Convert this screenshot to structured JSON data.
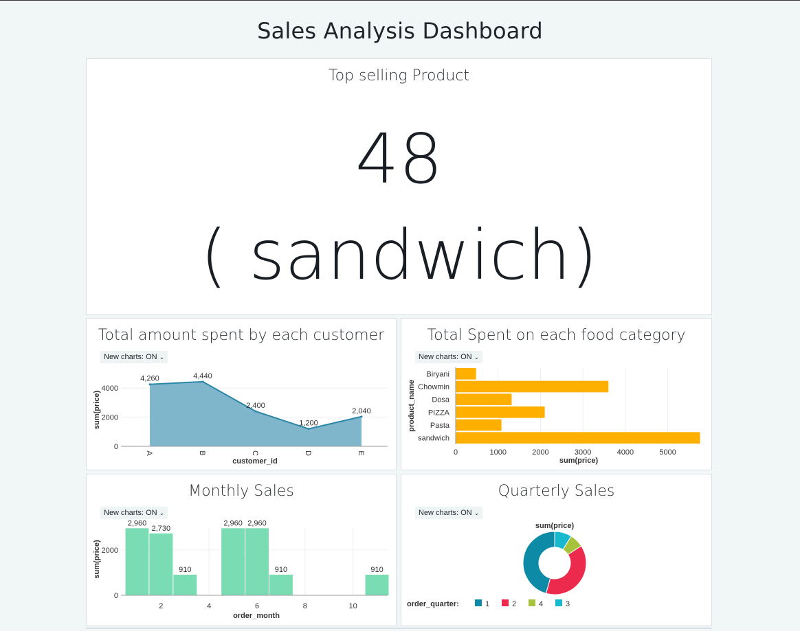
{
  "dashboard": {
    "title": "Sales Analysis Dashboard"
  },
  "kpi": {
    "title": "Top selling Product",
    "value": "48",
    "subtitle": "( sandwich)"
  },
  "toggle_label": "New charts: ON",
  "colors": {
    "area": "#7fb6cb",
    "area_line": "#2c86a6",
    "bars_h": "#ffaf00",
    "bars_month": "#7adcb3",
    "pie": [
      "#0c8aa6",
      "#ec2a4d",
      "#a7c33b",
      "#18b9cf"
    ]
  },
  "chart_data": [
    {
      "id": "customer",
      "type": "area",
      "title": "Total amount spent by each customer",
      "xlabel": "customer_id",
      "ylabel": "sum(price)",
      "categories": [
        "A",
        "B",
        "C",
        "D",
        "E"
      ],
      "values": [
        4260,
        4440,
        2400,
        1200,
        2040
      ],
      "value_labels": [
        "4,260",
        "4,440",
        "2,400",
        "1,200",
        "2,040"
      ],
      "ylim": [
        0,
        5000
      ],
      "yticks": [
        0,
        2000,
        4000
      ]
    },
    {
      "id": "category",
      "type": "bar",
      "orientation": "horizontal",
      "title": "Total Spent on each food category",
      "xlabel": "sum(price)",
      "ylabel": "product_name",
      "categories": [
        "Biryani",
        "Chowmin",
        "Dosa",
        "PIZZA",
        "Pasta",
        "sandwich"
      ],
      "values": [
        480,
        3600,
        1320,
        2100,
        1080,
        5760
      ],
      "xlim": [
        0,
        5800
      ],
      "xticks": [
        0,
        1000,
        2000,
        3000,
        4000,
        5000
      ]
    },
    {
      "id": "monthly",
      "type": "bar",
      "title": "Monthly Sales",
      "xlabel": "order_month",
      "ylabel": "sum(price)",
      "x": [
        1,
        2,
        3,
        5,
        6,
        7,
        11
      ],
      "values": [
        2960,
        2730,
        910,
        2960,
        2960,
        910,
        910
      ],
      "value_labels": [
        "2,960",
        "2,730",
        "910",
        "2,960",
        "2,960",
        "910",
        "910"
      ],
      "xlim": [
        0.5,
        11.5
      ],
      "xticks": [
        2,
        4,
        6,
        8,
        10
      ],
      "ylim": [
        0,
        3000
      ],
      "yticks": [
        0,
        2000
      ]
    },
    {
      "id": "quarterly",
      "type": "pie",
      "title": "Quarterly Sales",
      "chart_label": "sum(price)",
      "legend_title": "order_quarter:",
      "labels": [
        "1",
        "2",
        "4",
        "3"
      ],
      "values": [
        45.6,
        38.5,
        7.1,
        8.8
      ]
    }
  ]
}
